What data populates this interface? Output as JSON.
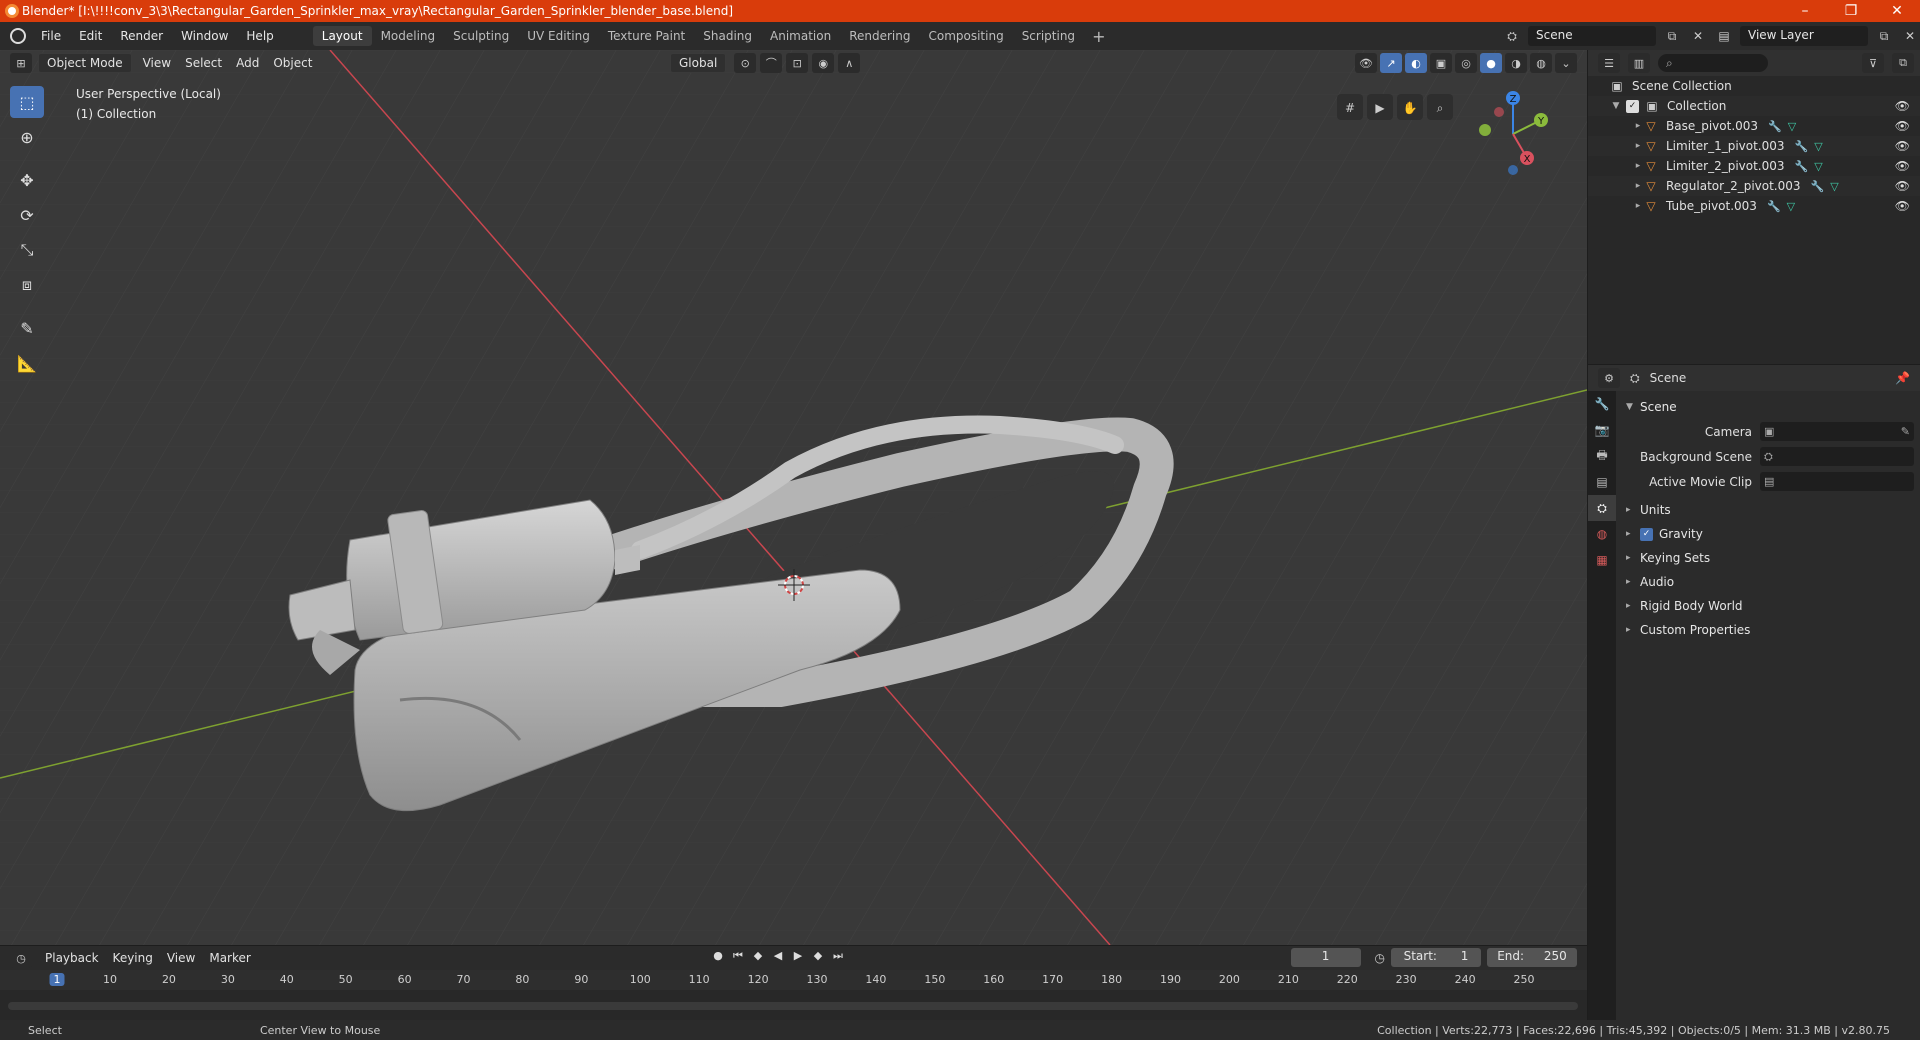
{
  "window": {
    "title": "Blender* [I:\\!!!!conv_3\\3\\Rectangular_Garden_Sprinkler_max_vray\\Rectangular_Garden_Sprinkler_blender_base.blend]",
    "minimize": "–",
    "maximize": "❐",
    "close": "✕"
  },
  "menu": {
    "items": [
      "File",
      "Edit",
      "Render",
      "Window",
      "Help"
    ],
    "workspaces": [
      "Layout",
      "Modeling",
      "Sculpting",
      "UV Editing",
      "Texture Paint",
      "Shading",
      "Animation",
      "Rendering",
      "Compositing",
      "Scripting"
    ],
    "active_workspace": "Layout",
    "add_label": "+",
    "scene": "Scene",
    "view_layer": "View Layer"
  },
  "viewport": {
    "mode": "Object Mode",
    "menus": [
      "View",
      "Select",
      "Add",
      "Object"
    ],
    "transform": "Global",
    "info_line1": "User Perspective (Local)",
    "info_line2": "(1) Collection",
    "gizmo_axes": {
      "z": "Z",
      "y": "Y",
      "x": "X"
    },
    "colors": {
      "x_axis": "#d9515e",
      "y_axis": "#8bbb3c",
      "z_axis": "#3b85e6",
      "accent": "#4772b3"
    }
  },
  "outliner": {
    "root": "Scene Collection",
    "collection": "Collection",
    "objects": [
      "Base_pivot.003",
      "Limiter_1_pivot.003",
      "Limiter_2_pivot.003",
      "Regulator_2_pivot.003",
      "Tube_pivot.003"
    ]
  },
  "properties": {
    "context": "Scene",
    "section": "Scene",
    "fields": [
      {
        "label": "Camera"
      },
      {
        "label": "Background Scene"
      },
      {
        "label": "Active Movie Clip"
      }
    ],
    "panels": [
      "Units",
      "Gravity",
      "Keying Sets",
      "Audio",
      "Rigid Body World",
      "Custom Properties"
    ]
  },
  "timeline": {
    "menus": [
      "Playback",
      "Keying",
      "View",
      "Marker"
    ],
    "current_frame": "1",
    "start_label": "Start:",
    "start": "1",
    "end_label": "End:",
    "end": "250",
    "ticks": [
      "1",
      "10",
      "20",
      "30",
      "40",
      "50",
      "60",
      "70",
      "80",
      "90",
      "100",
      "110",
      "120",
      "130",
      "140",
      "150",
      "160",
      "170",
      "180",
      "190",
      "200",
      "210",
      "220",
      "230",
      "240",
      "250"
    ]
  },
  "statusbar": {
    "select": "Select",
    "center_view": "Center View to Mouse",
    "stats": "Collection | Verts:22,773 | Faces:22,696 | Tris:45,392 | Objects:0/5 | Mem: 31.3 MB | v2.80.75"
  }
}
